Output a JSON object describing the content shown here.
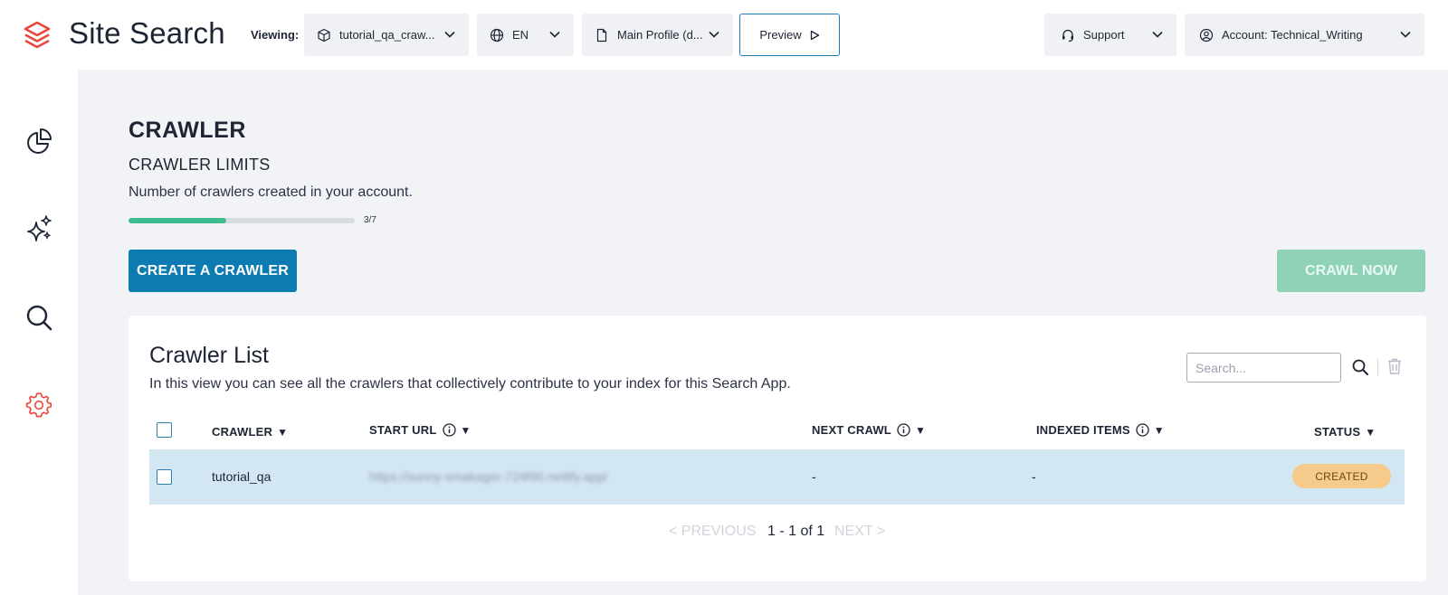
{
  "header": {
    "brand": "Site Search",
    "viewing_label": "Viewing:",
    "app_select": "tutorial_qa_craw...",
    "lang_select": "EN",
    "profile_select": "Main Profile (d...",
    "preview_label": "Preview",
    "support_label": "Support",
    "account_label": "Account: Technical_Writing"
  },
  "sidebar": {
    "items": [
      {
        "icon": "pie-chart-icon"
      },
      {
        "icon": "sparkles-icon"
      },
      {
        "icon": "search-icon"
      },
      {
        "icon": "gear-icon",
        "active": true
      }
    ]
  },
  "page": {
    "title": "CRAWLER",
    "limits_title": "CRAWLER LIMITS",
    "limits_desc": "Number of crawlers created in your account.",
    "progress_text": "3/7",
    "progress_fraction": 0.43,
    "create_button": "CREATE A CRAWLER",
    "crawl_now_button": "CRAWL NOW"
  },
  "crawler_list": {
    "title": "Crawler List",
    "description": "In this view you can see all the crawlers that collectively contribute to your index for this Search App.",
    "search_placeholder": "Search...",
    "columns": [
      "CRAWLER",
      "START URL",
      "NEXT CRAWL",
      "INDEXED ITEMS",
      "STATUS"
    ],
    "rows": [
      {
        "crawler": "tutorial_qa",
        "start_url": "https://sunny-smakager-724f90.netlify.app/",
        "next_crawl": "-",
        "indexed_items": "-",
        "status": "CREATED"
      }
    ],
    "pagination": {
      "previous": "< PREVIOUS",
      "info": "1 - 1 of 1",
      "next": "NEXT >"
    }
  },
  "colors": {
    "primary": "#0b7bb2",
    "accent_green": "#3dbc8e",
    "crawl_disabled": "#8fd2b8",
    "active_sidebar": "#e8483b",
    "status_created": "#f6ca8a",
    "row_selected": "#d3e7f2",
    "background": "#f2f3f7"
  }
}
